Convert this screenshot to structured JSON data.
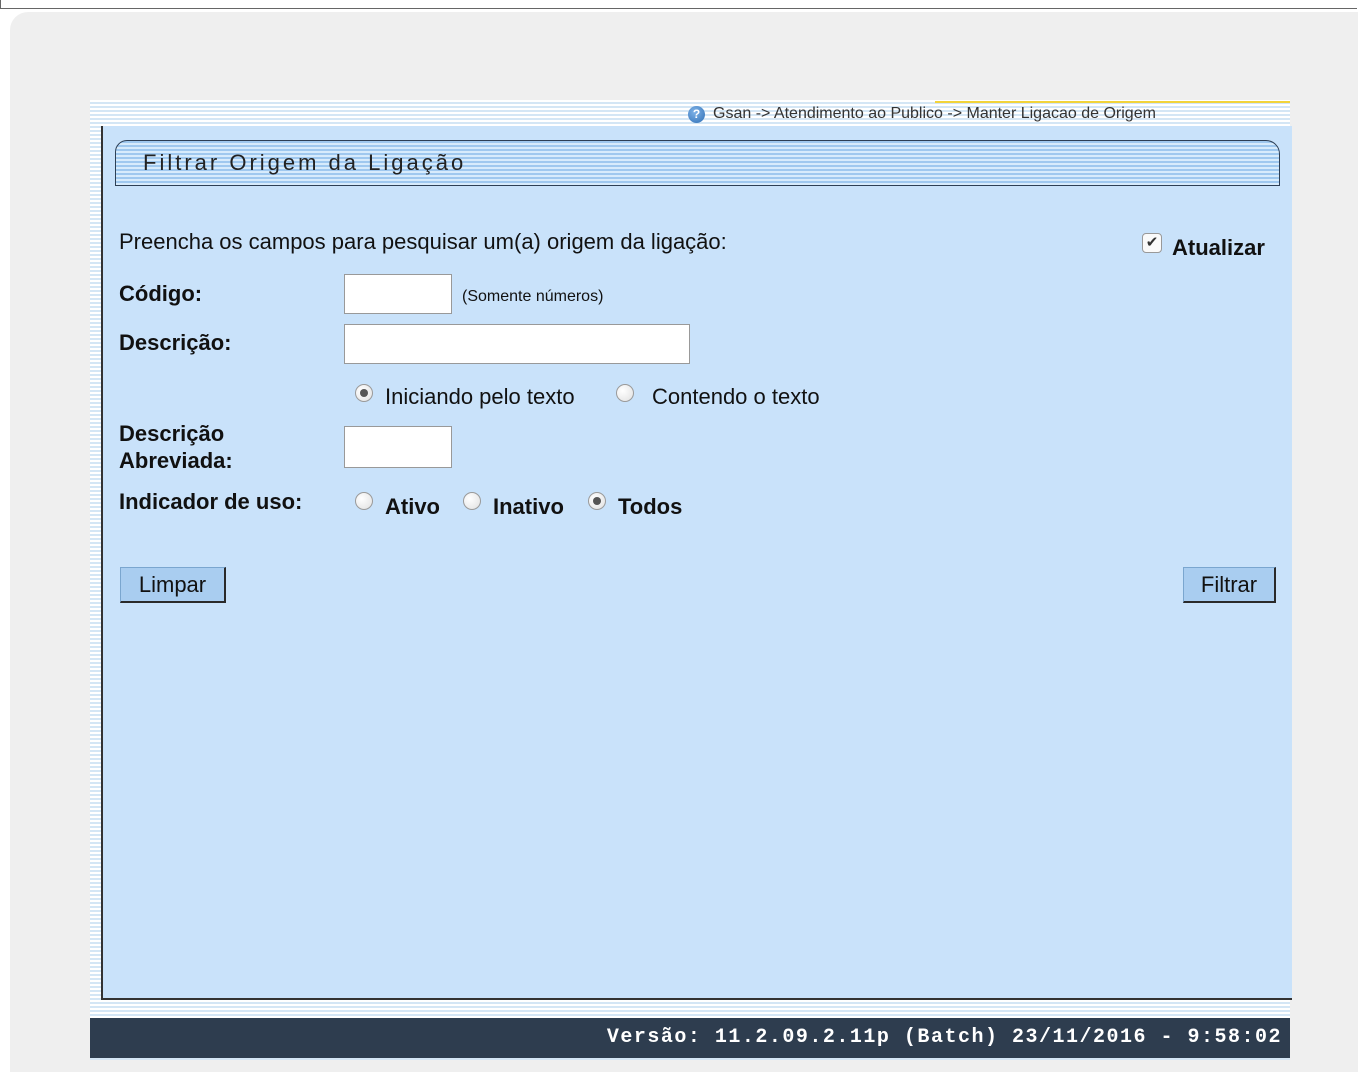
{
  "breadcrumb": {
    "text": "Gsan -> Atendimento ao Publico -> Manter Ligacao de Origem"
  },
  "form": {
    "title": "Filtrar Origem da Ligação",
    "instruction": "Preencha os campos para pesquisar um(a) origem da ligação:",
    "atualizar": {
      "label": "Atualizar",
      "checked": true
    },
    "codigo": {
      "label": "Código:",
      "value": "",
      "hint": "(Somente números)"
    },
    "descricao": {
      "label": "Descrição:",
      "value": "",
      "option_iniciando": "Iniciando pelo texto",
      "option_contendo": "Contendo o texto",
      "selected": "Iniciando pelo texto"
    },
    "descricao_abreviada": {
      "label_line1": "Descrição",
      "label_line2": "Abreviada:",
      "value": ""
    },
    "indicador_uso": {
      "label": "Indicador de uso:",
      "option_ativo": "Ativo",
      "option_inativo": "Inativo",
      "option_todos": "Todos",
      "selected": "Todos"
    },
    "buttons": {
      "limpar": "Limpar",
      "filtrar": "Filtrar"
    }
  },
  "footer": {
    "version": "Versão: 11.2.09.2.11p (Batch) 23/11/2016 - 9:58:02"
  }
}
